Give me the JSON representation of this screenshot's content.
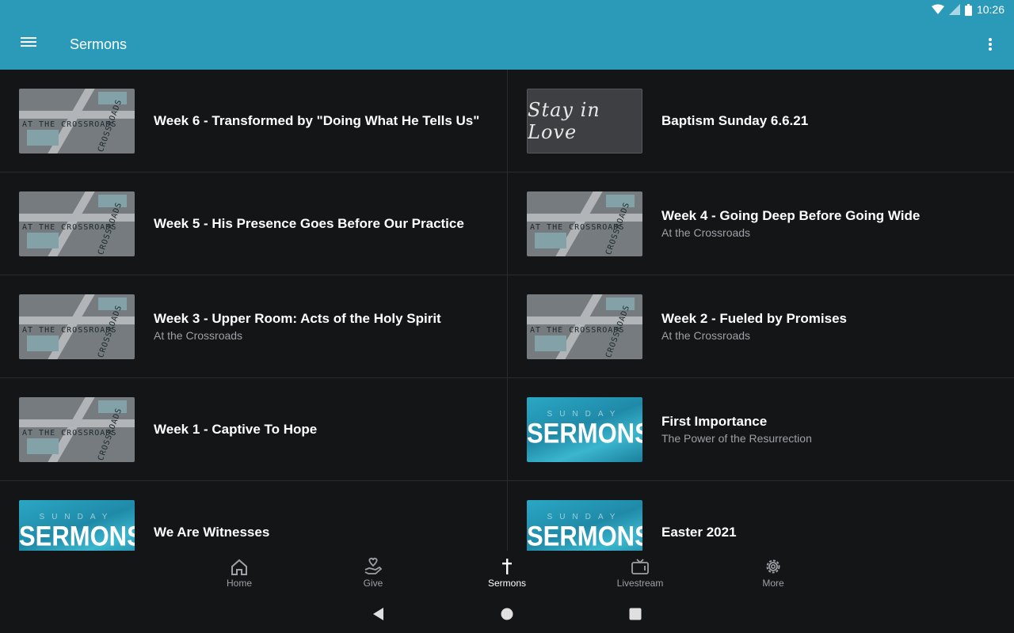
{
  "status_bar": {
    "time": "10:26"
  },
  "app_bar": {
    "title": "Sermons"
  },
  "sermons": [
    {
      "title": "Week 6 - Transformed by \"Doing What He Tells Us\"",
      "subtitle": "",
      "thumbnail": "crossroads"
    },
    {
      "title": "Baptism Sunday 6.6.21",
      "subtitle": "",
      "thumbnail": "stay-in-love"
    },
    {
      "title": "Week 5 - His Presence Goes Before Our Practice",
      "subtitle": "",
      "thumbnail": "crossroads"
    },
    {
      "title": "Week 4 - Going Deep Before Going Wide",
      "subtitle": "At the Crossroads",
      "thumbnail": "crossroads"
    },
    {
      "title": "Week 3 - Upper Room: Acts of the Holy Spirit",
      "subtitle": "At the Crossroads",
      "thumbnail": "crossroads"
    },
    {
      "title": "Week 2 - Fueled by Promises",
      "subtitle": "At the Crossroads",
      "thumbnail": "crossroads"
    },
    {
      "title": "Week 1 - Captive To Hope",
      "subtitle": "",
      "thumbnail": "crossroads"
    },
    {
      "title": "First Importance",
      "subtitle": "The Power of the Resurrection",
      "thumbnail": "sunday-sermons"
    },
    {
      "title": "We Are Witnesses",
      "subtitle": "",
      "thumbnail": "sunday-sermons"
    },
    {
      "title": "Easter 2021",
      "subtitle": "",
      "thumbnail": "sunday-sermons"
    }
  ],
  "thumbnails": {
    "crossroads_line1": "AT THE CROSSROADS",
    "crossroads_line2": "CROSSROADS",
    "stay_in_love": "Stay in Love",
    "sunday": "SUNDAY",
    "sermons": "SERMONS"
  },
  "bottom_nav": [
    {
      "label": "Home",
      "icon": "home-icon",
      "active": false
    },
    {
      "label": "Give",
      "icon": "give-icon",
      "active": false
    },
    {
      "label": "Sermons",
      "icon": "cross-icon",
      "active": true
    },
    {
      "label": "Livestream",
      "icon": "tv-icon",
      "active": false
    },
    {
      "label": "More",
      "icon": "gear-icon",
      "active": false
    }
  ],
  "colors": {
    "accent": "#2b9ab8",
    "background": "#141517",
    "divider": "#2a2b2e"
  }
}
